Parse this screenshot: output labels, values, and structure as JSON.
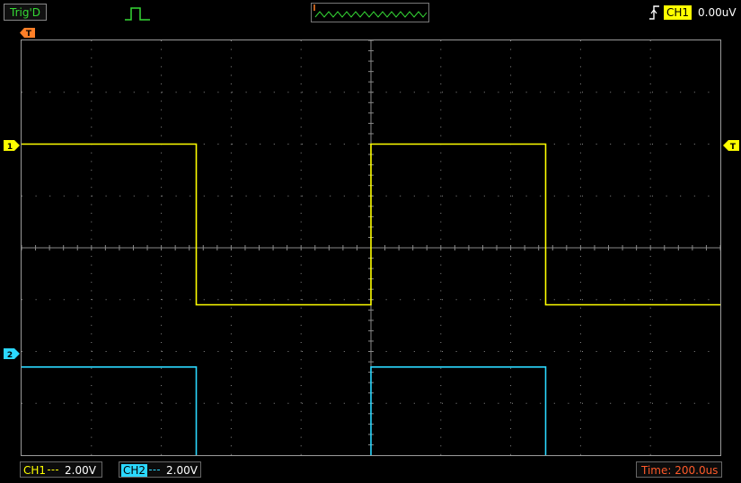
{
  "status": {
    "acquisition": "Trig'D"
  },
  "trigger": {
    "channel": "CH1",
    "level": "0.00uV",
    "edge_icon": "rising-edge-icon",
    "pulse_icon": "pulse-icon"
  },
  "markers": {
    "trigger_position": "T",
    "ch1": "1",
    "ch2": "2",
    "trigger_level": "T"
  },
  "channels": [
    {
      "name": "CH1",
      "scale": "2.00V",
      "color": "#ffff00"
    },
    {
      "name": "CH2",
      "scale": "2.00V",
      "color": "#2bd8ff"
    }
  ],
  "timebase": {
    "label": "Time: 200.0us"
  },
  "display": {
    "grid_divisions": {
      "x": 10,
      "y": 8
    },
    "colors": {
      "ch1": "#ffff00",
      "ch2": "#2bd8ff",
      "status": "#35d935",
      "marker": "#ff7f27",
      "timebase": "#ff5a2a"
    }
  },
  "chart_data": {
    "type": "line",
    "x": [
      0,
      2.5,
      2.5,
      5,
      5,
      7.5,
      7.5,
      10
    ],
    "series": [
      {
        "name": "CH1",
        "values": [
          2,
          2,
          -1.1,
          -1.1,
          2,
          2,
          -1.1,
          -1.1
        ]
      },
      {
        "name": "CH2",
        "values": [
          -2.3,
          -2.3,
          -4.3,
          -4.3,
          -2.3,
          -2.3,
          -4.3,
          -4.3
        ]
      }
    ],
    "xlim": [
      0,
      10
    ],
    "ylim": [
      -4,
      4
    ],
    "grid": true
  }
}
